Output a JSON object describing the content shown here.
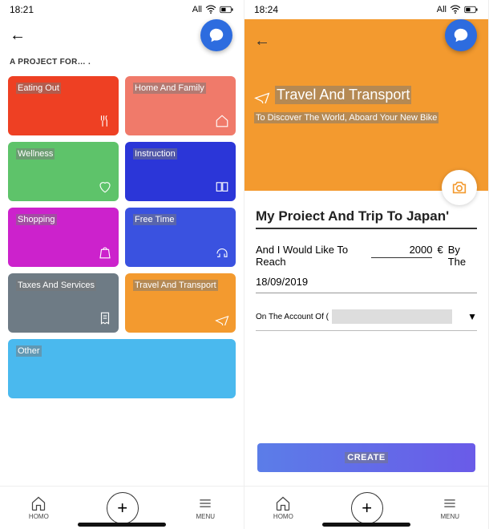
{
  "left": {
    "status": {
      "time": "18:21",
      "carrier": "All"
    },
    "section_label": "A PROJECT FOR… .",
    "tiles": [
      {
        "label": "Eating Out",
        "color": "#ee4023",
        "icon": "dining-icon"
      },
      {
        "label": "Home And Family",
        "color": "#f07a6a",
        "icon": "home-icon"
      },
      {
        "label": "Wellness",
        "color": "#5ec36a",
        "icon": "heart-icon"
      },
      {
        "label": "Instruction",
        "color": "#2b36d8",
        "icon": "book-icon"
      },
      {
        "label": "Shopping",
        "color": "#cc22cc",
        "icon": "bag-icon"
      },
      {
        "label": "Free Time",
        "color": "#3a52e0",
        "icon": "headphones-icon"
      },
      {
        "label": "Taxes And Services",
        "color": "#6e7b85",
        "icon": "receipt-icon"
      },
      {
        "label": "Travel And Transport",
        "color": "#f39a2f",
        "icon": "plane-icon"
      },
      {
        "label": "Other",
        "color": "#4ab9ee",
        "icon": "",
        "full": true
      }
    ],
    "nav": {
      "home": "HOMO",
      "menu": "MENU"
    }
  },
  "right": {
    "status": {
      "time": "18:24",
      "carrier": "All"
    },
    "hero": {
      "title": "Travel And Transport",
      "subtitle": "To Discover The World, Aboard Your New Bike"
    },
    "form": {
      "project_name": "My Proiect And Trip To Japan'",
      "amount_prefix": "And I Would Like To Reach",
      "amount_value": "2000",
      "currency": "€",
      "amount_suffix": "By The",
      "date": "18/09/2019",
      "account_label": "On The Account Of (",
      "create_label": "CREATE"
    },
    "nav": {
      "home": "HOMO",
      "menu": "MENU"
    }
  }
}
